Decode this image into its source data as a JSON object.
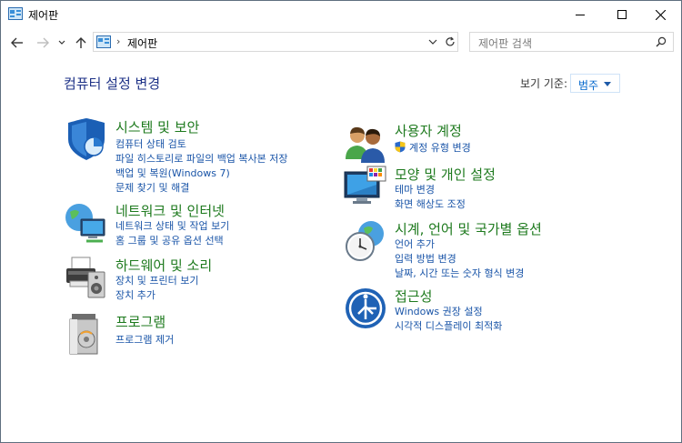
{
  "window": {
    "title": "제어판"
  },
  "nav": {
    "address_text": "제어판",
    "search_placeholder": "제어판 검색"
  },
  "header": {
    "page_title": "컴퓨터 설정 변경",
    "view_by_label": "보기 기준:",
    "view_by_value": "범주"
  },
  "categories": [
    {
      "title": "시스템 및 보안",
      "links": [
        "컴퓨터 상태 검토",
        "파일 히스토리로 파일의 백업 복사본 저장",
        "백업 및 복원(Windows 7)",
        "문제 찾기 및 해결"
      ]
    },
    {
      "title": "네트워크 및 인터넷",
      "links": [
        "네트워크 상태 및 작업 보기",
        "홈 그룹 및 공유 옵션 선택"
      ]
    },
    {
      "title": "하드웨어 및 소리",
      "links": [
        "장치 및 프린터 보기",
        "장치 추가"
      ]
    },
    {
      "title": "프로그램",
      "links": [
        "프로그램 제거"
      ]
    },
    {
      "title": "사용자 계정",
      "links": [
        "계정 유형 변경"
      ]
    },
    {
      "title": "모양 및 개인 설정",
      "links": [
        "테마 변경",
        "화면 해상도 조정"
      ]
    },
    {
      "title": "시계, 언어 및 국가별 옵션",
      "links": [
        "언어 추가",
        "입력 방법 변경",
        "날짜, 시간 또는 숫자 형식 변경"
      ]
    },
    {
      "title": "접근성",
      "links": [
        "Windows 권장 설정",
        "시각적 디스플레이 최적화"
      ]
    }
  ]
}
